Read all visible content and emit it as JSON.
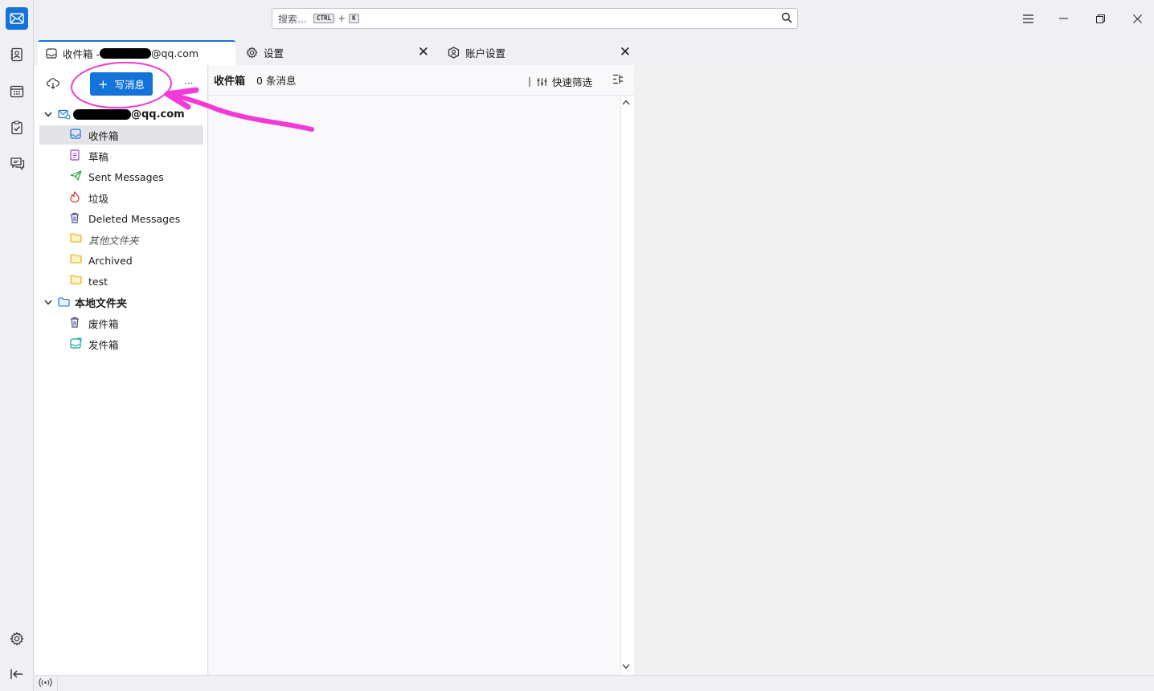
{
  "search": {
    "placeholder": "搜索…",
    "shortcut_mod": "CTRL",
    "shortcut_plus": "+",
    "shortcut_key": "K"
  },
  "tabs": [
    {
      "label": "收件箱 - ",
      "suffix": "@qq.com",
      "active": true
    },
    {
      "label": "设置",
      "active": false
    },
    {
      "label": "账户设置",
      "active": false
    }
  ],
  "folder_pane": {
    "compose_label": "写消息",
    "compose_plus": "+",
    "more": "···",
    "account_suffix": "@qq.com",
    "folders": [
      {
        "label": "收件箱",
        "icon": "inbox-icon"
      },
      {
        "label": "草稿",
        "icon": "drafts-icon"
      },
      {
        "label": "Sent Messages",
        "icon": "sent-icon"
      },
      {
        "label": "垃圾",
        "icon": "junk-icon"
      },
      {
        "label": "Deleted Messages",
        "icon": "trash-icon"
      },
      {
        "label": "其他文件夹",
        "icon": "folder-icon"
      },
      {
        "label": "Archived",
        "icon": "folder-icon"
      },
      {
        "label": "test",
        "icon": "folder-icon"
      }
    ],
    "local_account": "本地文件夹",
    "local_folders": [
      {
        "label": "废件箱",
        "icon": "trash-icon"
      },
      {
        "label": "发件箱",
        "icon": "outbox-icon"
      }
    ]
  },
  "message_list": {
    "title": "收件箱",
    "count": "0 条消息",
    "quick_filter": "快速筛选"
  },
  "colors": {
    "accent": "#1373d9",
    "annotation": "#f23bd6"
  }
}
